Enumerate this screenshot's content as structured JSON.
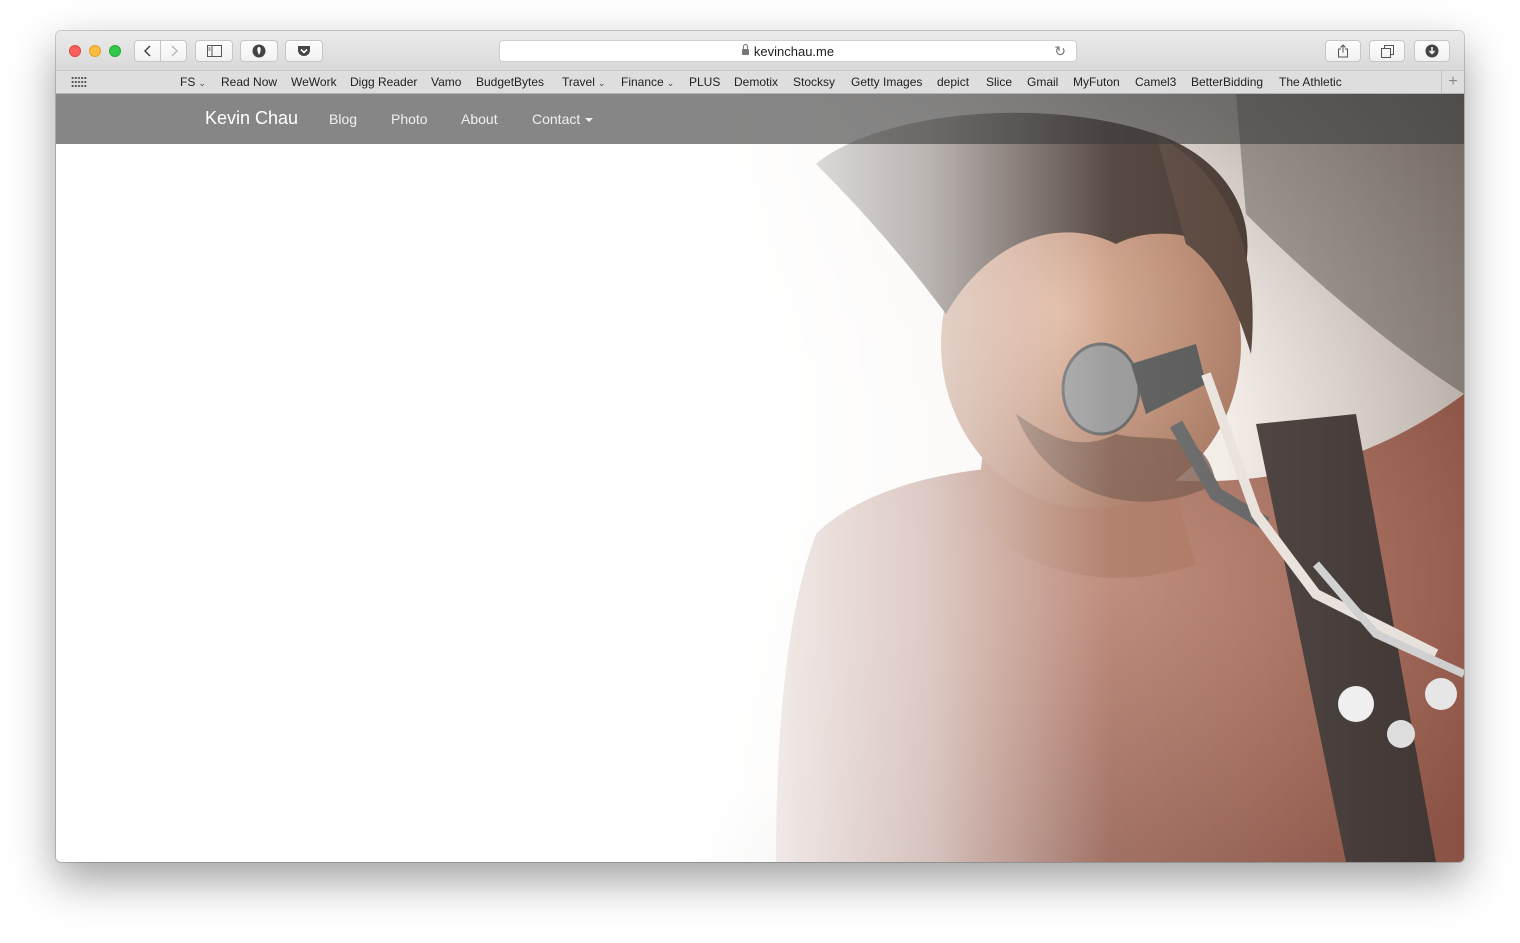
{
  "browser": {
    "url": "kevinchau.me",
    "bookmarks": [
      {
        "label": "FS",
        "dropdown": true
      },
      {
        "label": "Read Now",
        "dropdown": false
      },
      {
        "label": "WeWork",
        "dropdown": false
      },
      {
        "label": "Digg Reader",
        "dropdown": false
      },
      {
        "label": "Vamo",
        "dropdown": false
      },
      {
        "label": "BudgetBytes",
        "dropdown": false
      },
      {
        "label": "Travel",
        "dropdown": true
      },
      {
        "label": "Finance",
        "dropdown": true
      },
      {
        "label": "PLUS",
        "dropdown": false
      },
      {
        "label": "Demotix",
        "dropdown": false
      },
      {
        "label": "Stocksy",
        "dropdown": false
      },
      {
        "label": "Getty Images",
        "dropdown": false
      },
      {
        "label": "depict",
        "dropdown": false
      },
      {
        "label": "Slice",
        "dropdown": false
      },
      {
        "label": "Gmail",
        "dropdown": false
      },
      {
        "label": "MyFuton",
        "dropdown": false
      },
      {
        "label": "Camel3",
        "dropdown": false
      },
      {
        "label": "BetterBidding",
        "dropdown": false
      },
      {
        "label": "The Athletic",
        "dropdown": false
      }
    ],
    "icons": {
      "back": "chevron-left-icon",
      "forward": "chevron-right-icon",
      "sidebar": "sidebar-icon",
      "extension": "shield-icon",
      "pocket": "pocket-icon",
      "share": "share-icon",
      "tabs": "tabs-icon",
      "downloads": "download-icon",
      "reload": "reload-icon",
      "lock": "lock-icon",
      "new_tab": "plus-icon"
    }
  },
  "site": {
    "brand": "Kevin Chau",
    "nav": {
      "blog": "Blog",
      "photo": "Photo",
      "about": "About",
      "contact": "Contact"
    },
    "hero_image": "singer-with-microphone-photo"
  },
  "colors": {
    "navbar_bg": "#5e5e5e",
    "traffic_close": "#fc605c",
    "traffic_minimize": "#fdbc40",
    "traffic_maximize": "#34c84a"
  }
}
